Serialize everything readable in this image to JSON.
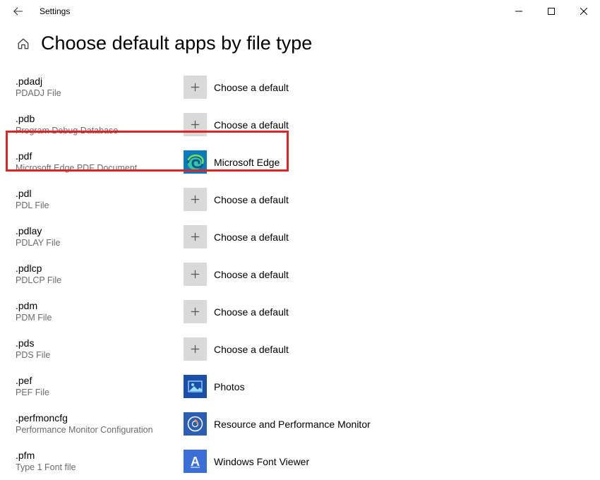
{
  "window": {
    "title": "Settings"
  },
  "page": {
    "title": "Choose default apps by file type"
  },
  "rows": [
    {
      "ext": ".pdadj",
      "desc": "PDADJ File",
      "app_label": "Choose a default",
      "icon": "plus"
    },
    {
      "ext": ".pdb",
      "desc": "Program Debug Database",
      "app_label": "Choose a default",
      "icon": "plus"
    },
    {
      "ext": ".pdf",
      "desc": "Microsoft Edge PDF Document",
      "app_label": "Microsoft Edge",
      "icon": "edge"
    },
    {
      "ext": ".pdl",
      "desc": "PDL File",
      "app_label": "Choose a default",
      "icon": "plus"
    },
    {
      "ext": ".pdlay",
      "desc": "PDLAY File",
      "app_label": "Choose a default",
      "icon": "plus"
    },
    {
      "ext": ".pdlcp",
      "desc": "PDLCP File",
      "app_label": "Choose a default",
      "icon": "plus"
    },
    {
      "ext": ".pdm",
      "desc": "PDM File",
      "app_label": "Choose a default",
      "icon": "plus"
    },
    {
      "ext": ".pds",
      "desc": "PDS File",
      "app_label": "Choose a default",
      "icon": "plus"
    },
    {
      "ext": ".pef",
      "desc": "PEF File",
      "app_label": "Photos",
      "icon": "photos"
    },
    {
      "ext": ".perfmoncfg",
      "desc": "Performance Monitor Configuration",
      "app_label": "Resource and Performance Monitor",
      "icon": "resmon"
    },
    {
      "ext": ".pfm",
      "desc": "Type 1 Font file",
      "app_label": "Windows Font Viewer",
      "icon": "fontview"
    }
  ]
}
